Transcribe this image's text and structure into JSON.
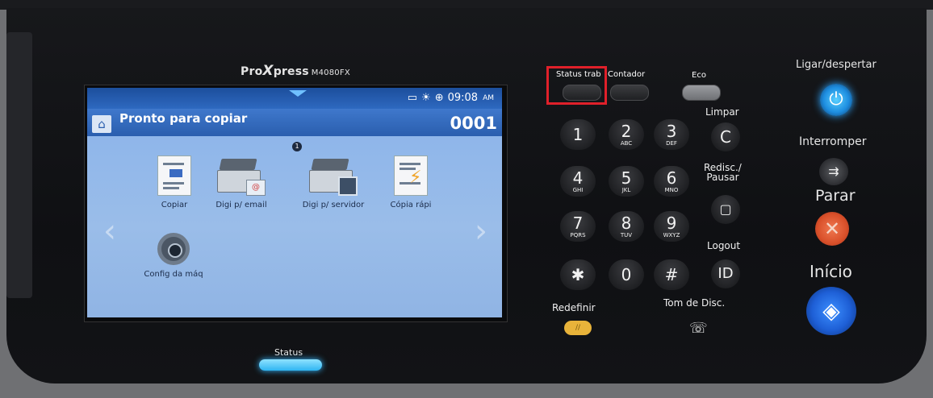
{
  "device": {
    "model_brand_pro": "Pro",
    "model_brand_x": "X",
    "model_brand_press": "press",
    "model_number": "M4080FX"
  },
  "lcd": {
    "time": "09:08",
    "ampm": "AM",
    "title": "Pronto para copiar",
    "counter": "0001",
    "page_indicator": "1",
    "tiles": [
      {
        "label": "Copiar",
        "icon": "copy-document-icon"
      },
      {
        "label": "Digi p/ email",
        "icon": "scan-to-email-icon"
      },
      {
        "label": "Digi p/ servidor",
        "icon": "scan-to-server-icon"
      },
      {
        "label": "Cópia rápi",
        "icon": "quick-copy-icon"
      },
      {
        "label": "Config da máq",
        "icon": "machine-settings-gear-icon"
      }
    ]
  },
  "status_button": {
    "label": "Status"
  },
  "function_buttons": {
    "status_trab": "Status trab",
    "contador": "Contador",
    "eco": "Eco"
  },
  "keypad": {
    "keys": [
      {
        "digit": "1",
        "letters": ""
      },
      {
        "digit": "2",
        "letters": "ABC"
      },
      {
        "digit": "3",
        "letters": "DEF"
      },
      {
        "digit": "4",
        "letters": "GHI"
      },
      {
        "digit": "5",
        "letters": "JKL"
      },
      {
        "digit": "6",
        "letters": "MNO"
      },
      {
        "digit": "7",
        "letters": "PQRS"
      },
      {
        "digit": "8",
        "letters": "TUV"
      },
      {
        "digit": "9",
        "letters": "WXYZ"
      },
      {
        "digit": "✱",
        "letters": ""
      },
      {
        "digit": "0",
        "letters": ""
      },
      {
        "digit": "#",
        "letters": ""
      }
    ]
  },
  "side_keys": {
    "limpar_label": "Limpar",
    "limpar_key": "C",
    "redisc_label_1": "Redisc./",
    "redisc_label_2": "Pausar",
    "logout_label": "Logout",
    "id_key": "ID",
    "redefinir_label": "Redefinir",
    "tom_disc_label": "Tom de Disc."
  },
  "right_column": {
    "ligar_label": "Ligar/despertar",
    "interromper_label": "Interromper",
    "parar_label": "Parar",
    "inicio_label": "Início"
  },
  "colors": {
    "highlight": "#e0202a",
    "lcd_blue": "#8fb4e6",
    "start_blue": "#1e5fd6",
    "stop_orange": "#d9502a",
    "power_blue": "#1d8de0",
    "status_led": "#2fb5f2",
    "reset_yellow": "#e8b33a"
  }
}
